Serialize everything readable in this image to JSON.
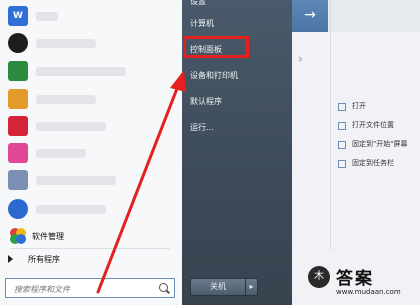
{
  "left_panel": {
    "app_software_label": "软件管理",
    "all_programs_label": "所有程序",
    "search": {
      "placeholder": "搜索程序和文件"
    }
  },
  "right_panel": {
    "items": [
      "设置",
      "计算机",
      "控制面板",
      "设备和打印机",
      "默认程序",
      "运行..."
    ],
    "shutdown_label": "关机",
    "shutdown_arrow": "▸"
  },
  "jump_list": {
    "header_arrow": "→",
    "items": [
      "打开",
      "打开文件位置",
      "固定到\"开始\"屏幕",
      "固定到任务栏"
    ]
  },
  "watermark": {
    "logo_text": "木",
    "title": "答案",
    "url": "www.mudaan.com"
  },
  "colors": {
    "highlight": "#e5201f",
    "right_panel": "#4a5a6a",
    "jump_header": "#5f88b6"
  }
}
